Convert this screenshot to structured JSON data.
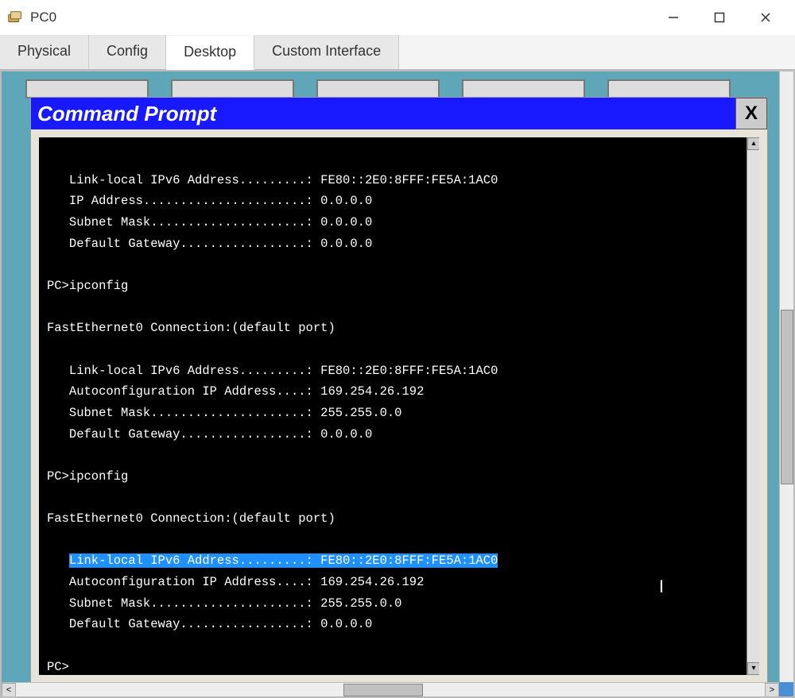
{
  "window": {
    "title": "PC0",
    "tabs": [
      "Physical",
      "Config",
      "Desktop",
      "Custom Interface"
    ],
    "active_tab_index": 2
  },
  "cmd": {
    "title": "Command Prompt",
    "close_label": "X"
  },
  "terminal": {
    "lines": [
      "",
      "   Link-local IPv6 Address.........: FE80::2E0:8FFF:FE5A:1AC0",
      "   IP Address......................: 0.0.0.0",
      "   Subnet Mask.....................: 0.0.0.0",
      "   Default Gateway.................: 0.0.0.0",
      "",
      "PC>ipconfig",
      "",
      "FastEthernet0 Connection:(default port)",
      "",
      "   Link-local IPv6 Address.........: FE80::2E0:8FFF:FE5A:1AC0",
      "   Autoconfiguration IP Address....: 169.254.26.192",
      "   Subnet Mask.....................: 255.255.0.0",
      "   Default Gateway.................: 0.0.0.0",
      "",
      "PC>ipconfig",
      "",
      "FastEthernet0 Connection:(default port)",
      "",
      "   Link-local IPv6 Address.........: FE80::2E0:8FFF:FE5A:1AC0",
      "   Autoconfiguration IP Address....: 169.254.26.192",
      "   Subnet Mask.....................: 255.255.0.0",
      "   Default Gateway.................: 0.0.0.0",
      "",
      "PC>"
    ],
    "selected_line_index": 19
  }
}
